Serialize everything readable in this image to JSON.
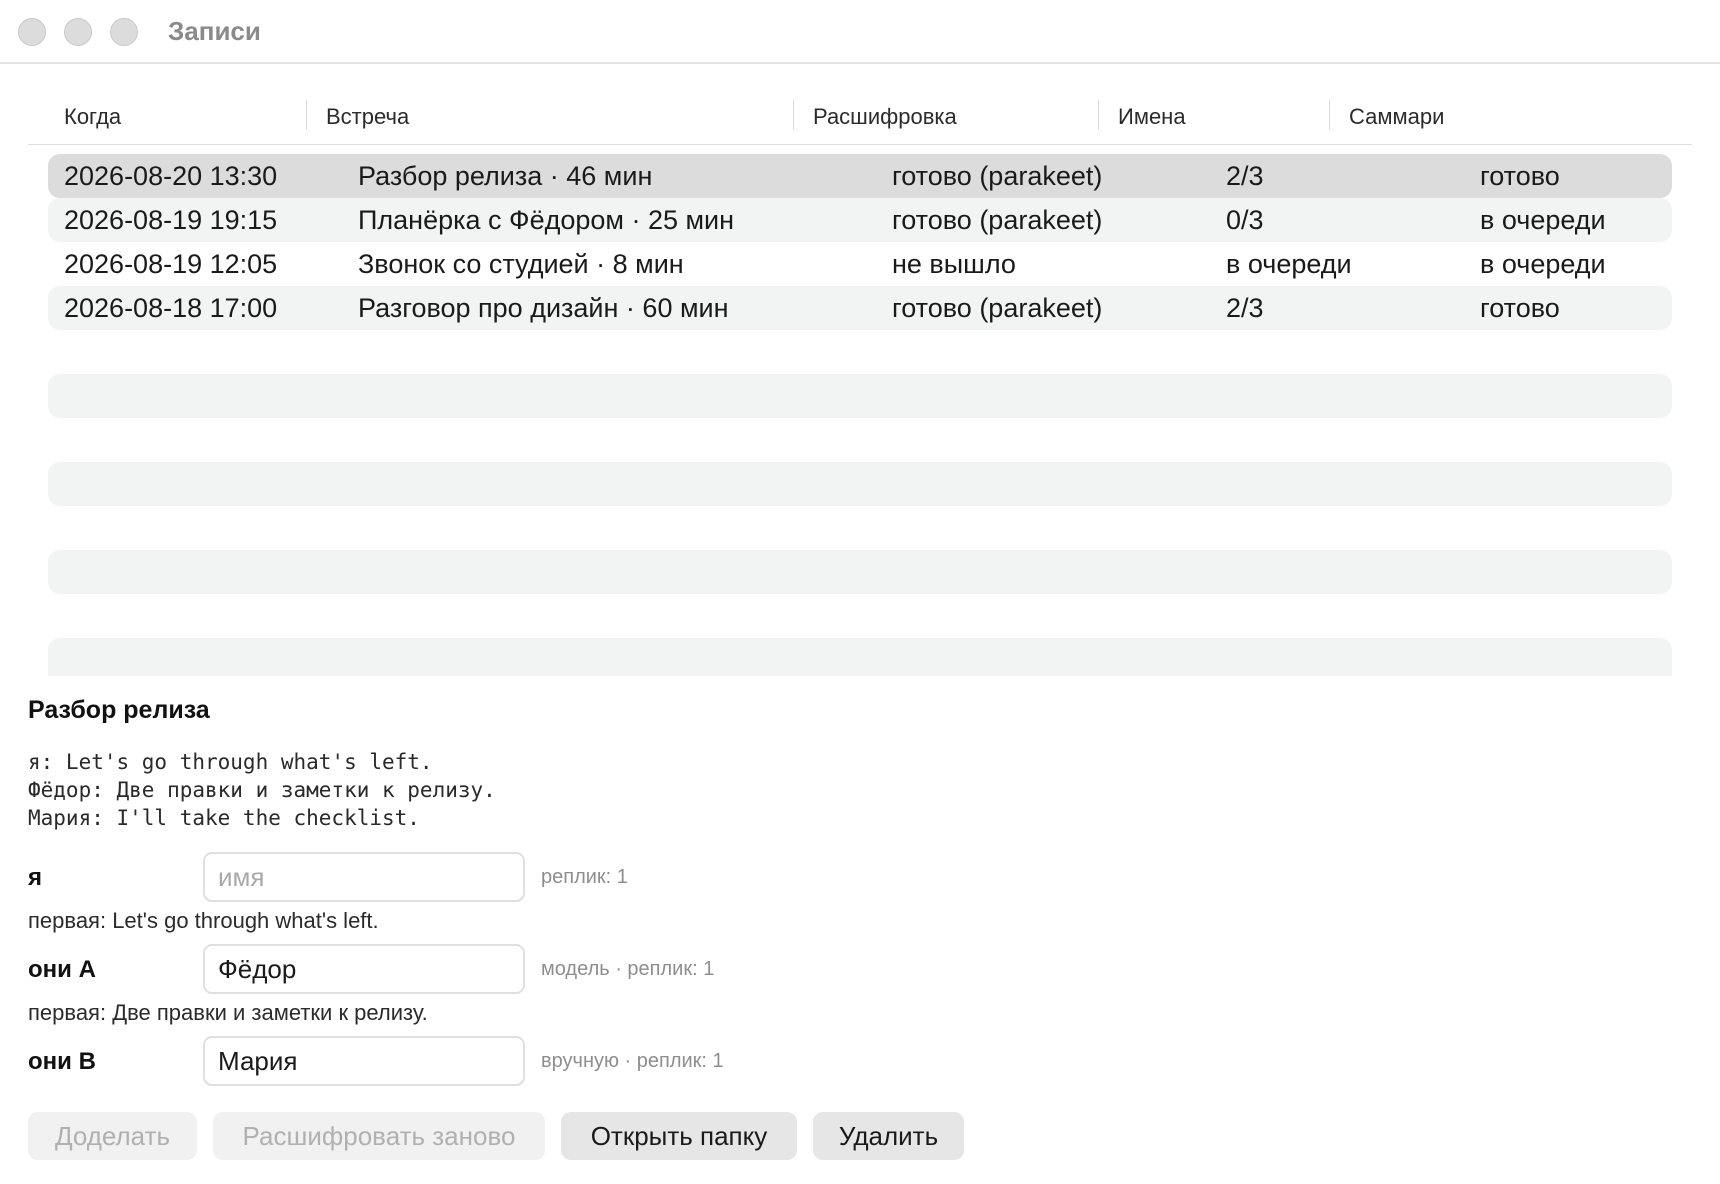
{
  "window": {
    "title": "Записи"
  },
  "table": {
    "columns": [
      "Когда",
      "Встреча",
      "Расшифровка",
      "Имена",
      "Саммари"
    ],
    "rows": [
      {
        "when": "2026-08-20 13:30",
        "meeting": "Разбор релиза · 46 мин",
        "transcript": "готово (parakeet)",
        "names": "2/3",
        "summary": "готово",
        "selected": true
      },
      {
        "when": "2026-08-19 19:15",
        "meeting": "Планёрка с Фёдором · 25 мин",
        "transcript": "готово (parakeet)",
        "names": "0/3",
        "summary": "в очереди",
        "selected": false
      },
      {
        "when": "2026-08-19 12:05",
        "meeting": "Звонок со студией · 8 мин",
        "transcript": "не вышло",
        "names": "в очереди",
        "summary": "в очереди",
        "selected": false
      },
      {
        "when": "2026-08-18 17:00",
        "meeting": "Разговор про дизайн · 60 мин",
        "transcript": "готово (parakeet)",
        "names": "2/3",
        "summary": "готово",
        "selected": false
      }
    ]
  },
  "detail": {
    "title": "Разбор релиза",
    "transcript_lines": [
      "я: Let's go through what's left.",
      "Фёдор: Две правки и заметки к релизу.",
      "Мария: I'll take the checklist."
    ],
    "speakers": [
      {
        "label": "я",
        "value": "",
        "placeholder": "имя",
        "meta": "реплик: 1",
        "first": "первая: Let's go through what's left."
      },
      {
        "label": "они А",
        "value": "Фёдор",
        "placeholder": "",
        "meta": "модель · реплик: 1",
        "first": "первая: Две правки и заметки к релизу."
      },
      {
        "label": "они B",
        "value": "Мария",
        "placeholder": "",
        "meta": "вручную · реплик: 1",
        "first": ""
      }
    ]
  },
  "buttons": {
    "redo": "Доделать",
    "retranscribe": "Расшифровать заново",
    "open_folder": "Открыть папку",
    "delete": "Удалить"
  }
}
